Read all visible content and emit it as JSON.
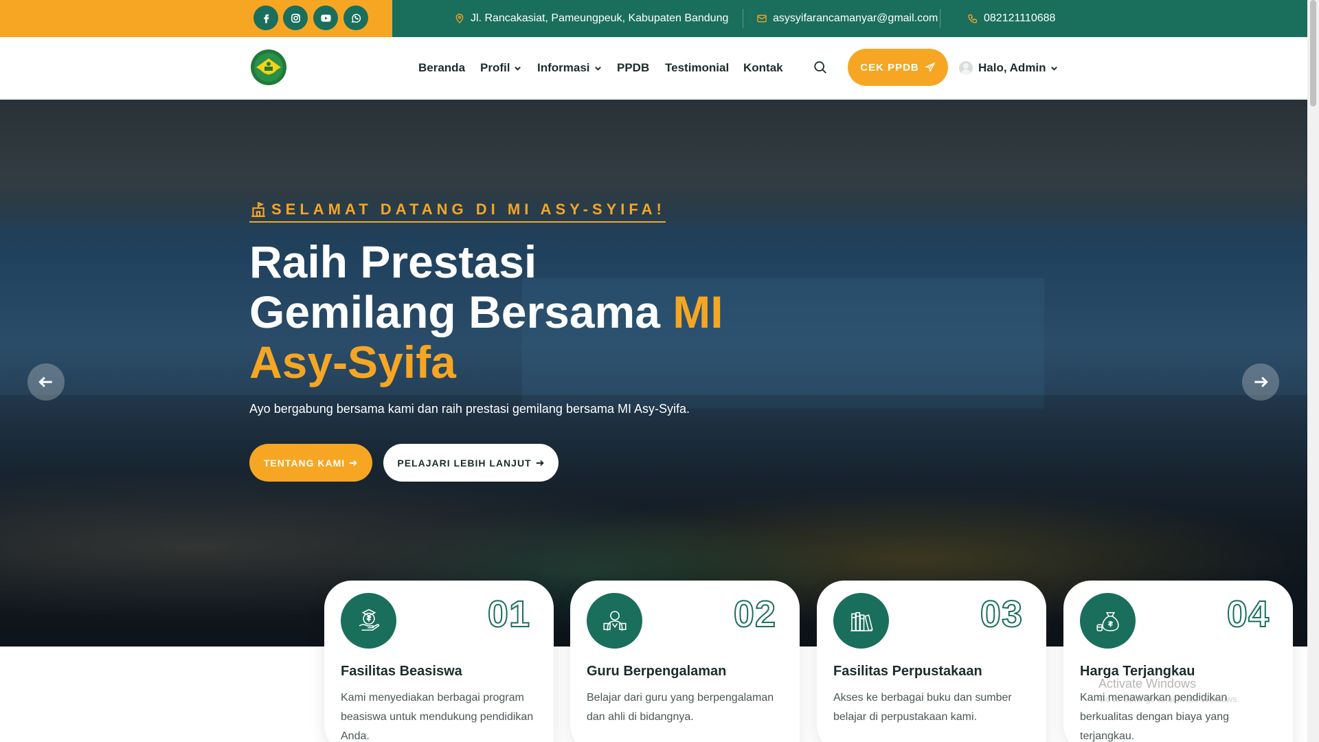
{
  "topbar": {
    "social": [
      {
        "icon": "facebook-icon",
        "name": "facebook"
      },
      {
        "icon": "instagram-icon",
        "name": "instagram"
      },
      {
        "icon": "youtube-icon",
        "name": "youtube"
      },
      {
        "icon": "whatsapp-icon",
        "name": "whatsapp"
      }
    ],
    "address": "Jl. Rancakasiat, Pameungpeuk, Kabupaten Bandung",
    "email": "asysyifarancamanyar@gmail.com",
    "phone": "082121110688"
  },
  "nav": {
    "items": [
      "Beranda",
      "Profil",
      "Informasi",
      "PPDB",
      "Testimonial",
      "Kontak"
    ],
    "cta_label": "CEK PPDB",
    "user_label": "Halo, Admin"
  },
  "hero": {
    "eyebrow": "SELAMAT DATANG DI MI ASY-SYIFA!",
    "title_line1": "Raih Prestasi",
    "title_line2": "Gemilang Bersama ",
    "title_highlight_a": "MI",
    "title_highlight_b": "Asy-Syifa",
    "subtitle": "Ayo bergabung bersama kami dan raih prestasi gemilang bersama MI Asy-Syifa.",
    "btn_primary": "TENTANG KAMI",
    "btn_secondary": "PELAJARI LEBIH LANJUT"
  },
  "features": [
    {
      "number": "01",
      "title": "Fasilitas Beasiswa",
      "desc": "Kami menyediakan berbagai program beasiswa untuk mendukung pendidikan Anda.",
      "icon": "scholarship-icon"
    },
    {
      "number": "02",
      "title": "Guru Berpengalaman",
      "desc": "Belajar dari guru yang berpengalaman dan ahli di bidangnya.",
      "icon": "teacher-icon"
    },
    {
      "number": "03",
      "title": "Fasilitas Perpustakaan",
      "desc": "Akses ke berbagai buku dan sumber belajar di perpustakaan kami.",
      "icon": "library-icon"
    },
    {
      "number": "04",
      "title": "Harga Terjangkau",
      "desc": "Kami menawarkan pendidikan berkualitas dengan biaya yang terjangkau.",
      "icon": "money-bag-icon"
    }
  ],
  "watermark": {
    "line1": "Activate Windows",
    "line2": "Go to Settings to activate Windows."
  },
  "colors": {
    "accent": "#f6a623",
    "primary": "#1a6e5c"
  }
}
